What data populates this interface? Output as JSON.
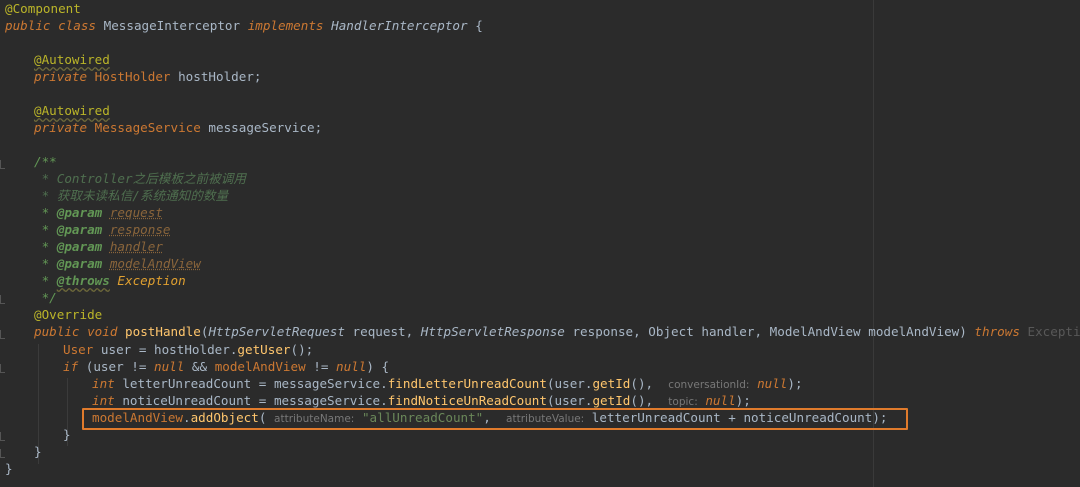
{
  "code": {
    "annotation_component": "@Component",
    "class_decl": {
      "public": "public",
      "class": "class",
      "name": "MessageInterceptor",
      "implements": "implements",
      "iface": "HandlerInterceptor",
      "brace": "{"
    },
    "field1": {
      "annotation": "@Autowired",
      "modifier": "private",
      "type": "HostHolder",
      "name": "hostHolder;"
    },
    "field2": {
      "annotation": "@Autowired",
      "modifier": "private",
      "type": "MessageService",
      "name": "messageService;"
    },
    "javadoc": {
      "open": "/**",
      "line1": " * Controller之后模板之前被调用",
      "line2": " * 获取未读私信/系统通知的数量",
      "star": " * ",
      "param_tag": "@param",
      "p1": "request",
      "p2": "response",
      "p3": "handler",
      "p4": "modelAndView",
      "throws_tag": "@throws",
      "throws_val": "Exception",
      "close": " */"
    },
    "override": "@Override",
    "method": {
      "public": "public",
      "void": "void",
      "name": "postHandle",
      "t1": "HttpServletRequest",
      "a1": "request,",
      "t2": "HttpServletResponse",
      "a2": "response,",
      "t3": "Object",
      "a3": "handler,",
      "t4": "ModelAndView",
      "a4": "modelAndView)",
      "throws": "throws",
      "exc": "Exception",
      "brace": "{"
    },
    "l_user": {
      "type": "User",
      "rest": " user = hostHolder.",
      "call": "getUser",
      "end": "();"
    },
    "l_if": {
      "if": "if",
      "p1": " (user != ",
      "null1": "null",
      "p2": " && ",
      "var": "modelAndView",
      "p3": " != ",
      "null2": "null",
      "p4": ") {"
    },
    "l_letter": {
      "int": "int",
      "p1": " letterUnreadCount = messageService.",
      "call": "findLetterUnreadCount",
      "p2": "(user.",
      "getid": "getId",
      "p3": "(),",
      "hint": "conversationId:",
      "null": "null",
      "end": ");"
    },
    "l_notice": {
      "int": "int",
      "p1": " noticeUnreadCount = messageService.",
      "call": "findNoticeUnReadCount",
      "p2": "(user.",
      "getid": "getId",
      "p3": "(),",
      "hint": "topic:",
      "null": "null",
      "end": ");"
    },
    "l_add": {
      "var": "modelAndView",
      "p1": ".",
      "call": "addObject",
      "p2": "(",
      "hint1": "attributeName:",
      "str": "\"allUnreadCount\"",
      "p3": ",",
      "hint2": "attributeValue:",
      "p4": " letterUnreadCount + noticeUnreadCount);"
    },
    "close_if": "}",
    "close_method": "}",
    "close_class": "}"
  },
  "colors": {
    "background": "#2b2b2b",
    "keyword": "#cc7832",
    "annotation": "#bbb529",
    "method": "#ffc66d",
    "string": "#6a8759",
    "comment": "#629755",
    "highlight_box": "#e07b2c"
  }
}
